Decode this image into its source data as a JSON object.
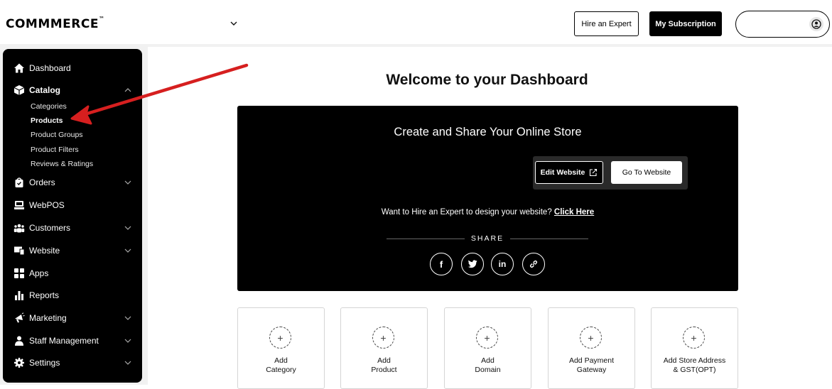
{
  "header": {
    "logo": "COMMMERCE",
    "logo_mark": "™",
    "hire_label": "Hire an Expert",
    "subscription_label": "My Subscription"
  },
  "sidebar": {
    "items": [
      {
        "label": "Dashboard",
        "icon": "home-icon"
      },
      {
        "label": "Catalog",
        "icon": "box-icon"
      },
      {
        "label": "Orders",
        "icon": "bag-icon"
      },
      {
        "label": "WebPOS",
        "icon": "pos-icon"
      },
      {
        "label": "Customers",
        "icon": "people-icon"
      },
      {
        "label": "Website",
        "icon": "website-icon"
      },
      {
        "label": "Apps",
        "icon": "apps-icon"
      },
      {
        "label": "Reports",
        "icon": "reports-icon"
      },
      {
        "label": "Marketing",
        "icon": "megaphone-icon"
      },
      {
        "label": "Staff Management",
        "icon": "staff-icon"
      },
      {
        "label": "Settings",
        "icon": "gear-icon"
      }
    ],
    "catalog_sub": [
      "Categories",
      "Products",
      "Product Groups",
      "Product Filters",
      "Reviews & Ratings"
    ]
  },
  "main": {
    "welcome": "Welcome to your Dashboard",
    "hero": {
      "title": "Create and Share Your Online Store",
      "edit_label": "Edit Website",
      "go_label": "Go To Website",
      "hire_text": "Want to Hire an Expert to design your website?",
      "hire_link": "Click Here",
      "share_label": "SHARE",
      "social": [
        "f",
        "t",
        "in",
        "link"
      ]
    },
    "cards": [
      {
        "label": "Add\nCategory"
      },
      {
        "label": "Add\nProduct"
      },
      {
        "label": "Add\nDomain"
      },
      {
        "label": "Add Payment\nGateway"
      },
      {
        "label": "Add Store Address\n& GST(OPT)"
      }
    ]
  },
  "colors": {
    "sidebar_bg": "#000000",
    "hero_bg": "#000000",
    "annotation_arrow": "#d61f1f"
  }
}
